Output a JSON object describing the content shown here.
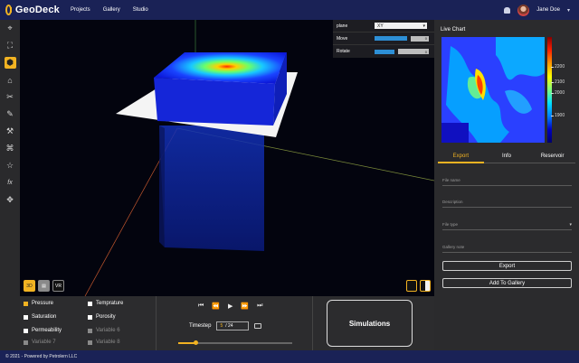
{
  "app": {
    "name": "GeoDeck",
    "nav": [
      "Projects",
      "Gallery",
      "Studio"
    ],
    "user_name": "Jane Doe"
  },
  "tools": [
    {
      "icon": "target-icon"
    },
    {
      "icon": "crop-icon"
    },
    {
      "icon": "cube-icon",
      "active": true
    },
    {
      "icon": "bank-icon"
    },
    {
      "icon": "scissors-icon"
    },
    {
      "icon": "pen-icon"
    },
    {
      "icon": "hammer-icon"
    },
    {
      "icon": "tag-icon"
    },
    {
      "icon": "star-icon"
    },
    {
      "icon": "function-icon",
      "text": "fx"
    },
    {
      "icon": "move-icon"
    }
  ],
  "viewport_controls": {
    "plane_label": "plane",
    "plane_value": "XY",
    "move_label": "Move",
    "move_value": "0",
    "rotate_label": "Rotate",
    "rotate_value": "0"
  },
  "mode_buttons": {
    "btn_3d": "3D",
    "btn_vr": "VR"
  },
  "variables": [
    {
      "label": "Pressure",
      "checked": true,
      "enabled": true
    },
    {
      "label": "Temprature",
      "checked": false,
      "enabled": true
    },
    {
      "label": "Saturation",
      "checked": false,
      "enabled": true
    },
    {
      "label": "Porosity",
      "checked": false,
      "enabled": true
    },
    {
      "label": "Permeability",
      "checked": false,
      "enabled": true
    },
    {
      "label": "Variable 6",
      "checked": false,
      "enabled": false
    },
    {
      "label": "Variable 7",
      "checked": false,
      "enabled": false
    },
    {
      "label": "Variable 8",
      "checked": false,
      "enabled": false
    }
  ],
  "player": {
    "timestep_label": "Timestep",
    "current": "5",
    "total": "/ 24",
    "progress": 0.15
  },
  "simulations_label": "Simulations",
  "right_panel": {
    "chart_title": "Live Chart",
    "colorbar_ticks": [
      "2200",
      "2100",
      "2000",
      "1900"
    ],
    "tabs": [
      "Export",
      "Info",
      "Reservoir"
    ],
    "active_tab": 0,
    "fields": {
      "file_name": "File name",
      "description": "Description",
      "file_type": "File type",
      "gallery_note": "Gallery note"
    },
    "export_button": "Export",
    "gallery_button": "Add To Gallery"
  },
  "footer": "© 2021 - Powered by Petrolern LLC",
  "colors": {
    "accent": "#f2b322",
    "topbar": "#1a2256",
    "panel": "#2b2b2d"
  }
}
